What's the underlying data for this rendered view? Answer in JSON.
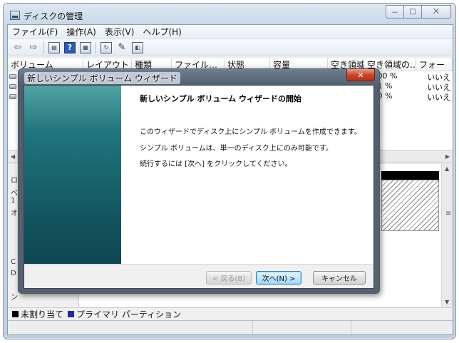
{
  "window": {
    "title": "ディスクの管理",
    "caption_buttons": [
      "－",
      "□",
      "⨉"
    ]
  },
  "menu": [
    "ファイル(F)",
    "操作(A)",
    "表示(V)",
    "ヘルプ(H)"
  ],
  "toolbar_icons": [
    "back-arrow-icon",
    "forward-arrow-icon",
    "list-view-icon",
    "help-icon",
    "properties-icon",
    "refresh-icon",
    "rescan-icon",
    "disk-properties-icon"
  ],
  "volume_list": {
    "columns": [
      "ボリューム",
      "レイアウト",
      "種類",
      "ファイル…",
      "状態",
      "容量",
      "空き領域",
      "空き領域の…",
      "フォー"
    ],
    "rows": [
      {
        "free_pct": "00 %",
        "fault": "いいえ"
      },
      {
        "free_pct": "1 %",
        "fault": "いいえ"
      },
      {
        "free_pct": "0 %",
        "fault": "いいえ"
      }
    ]
  },
  "graph_left_labels": [
    "ロ",
    "ベ",
    "1",
    "オ",
    "C",
    "D",
    "ン"
  ],
  "legend": [
    {
      "label": "未割り当て",
      "color": "#000000"
    },
    {
      "label": "プライマリ パーティション",
      "color": "#1f2a9c"
    }
  ],
  "wizard": {
    "title": "新しいシンプル ボリューム ウィザード",
    "heading": "新しいシンプル ボリューム ウィザードの開始",
    "lines": [
      "このウィザードでディスク上にシンプル ボリュームを作成できます。",
      "シンプル ボリュームは、単一のディスク上にのみ可能です。",
      "続行するには [次へ] をクリックしてください。"
    ],
    "buttons": {
      "back": "< 戻る(B)",
      "next": "次へ(N) >",
      "cancel": "キャンセル"
    }
  }
}
